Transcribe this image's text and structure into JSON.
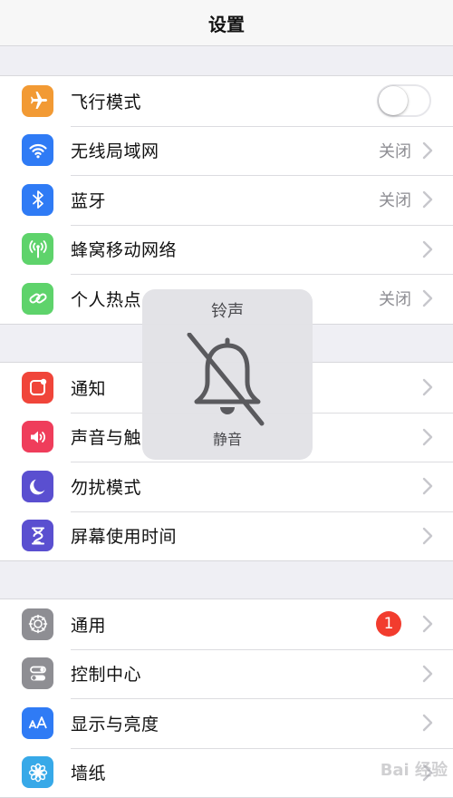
{
  "header": {
    "title": "设置"
  },
  "group1": [
    {
      "label": "飞行模式",
      "icon": "airplane-icon",
      "color": "#f29a34",
      "toggle": false
    },
    {
      "label": "无线局域网",
      "icon": "wifi-icon",
      "color": "#2f7bf5",
      "value": "关闭"
    },
    {
      "label": "蓝牙",
      "icon": "bluetooth-icon",
      "color": "#2f7bf5",
      "value": "关闭"
    },
    {
      "label": "蜂窝移动网络",
      "icon": "cellular-antenna-icon",
      "color": "#5ed36b"
    },
    {
      "label": "个人热点",
      "icon": "hotspot-link-icon",
      "color": "#5ed36b",
      "value": "关闭"
    }
  ],
  "group2": [
    {
      "label": "通知",
      "icon": "notification-icon",
      "color": "#f0453a"
    },
    {
      "label": "声音与触",
      "icon": "speaker-icon",
      "color": "#ef3d5b"
    },
    {
      "label": "勿扰模式",
      "icon": "moon-icon",
      "color": "#5a4fd0"
    },
    {
      "label": "屏幕使用时间",
      "icon": "hourglass-icon",
      "color": "#5a4fd0"
    }
  ],
  "group3": [
    {
      "label": "通用",
      "icon": "gear-icon",
      "color": "#8e8e93",
      "badge": "1"
    },
    {
      "label": "控制中心",
      "icon": "toggles-icon",
      "color": "#8e8e93"
    },
    {
      "label": "显示与亮度",
      "icon": "text-size-icon",
      "color": "#2f7bf5"
    },
    {
      "label": "墙纸",
      "icon": "flower-icon",
      "color": "#37a9e8"
    }
  ],
  "hud": {
    "title": "铃声",
    "subtitle": "静音"
  },
  "watermark": "Bai 经验"
}
